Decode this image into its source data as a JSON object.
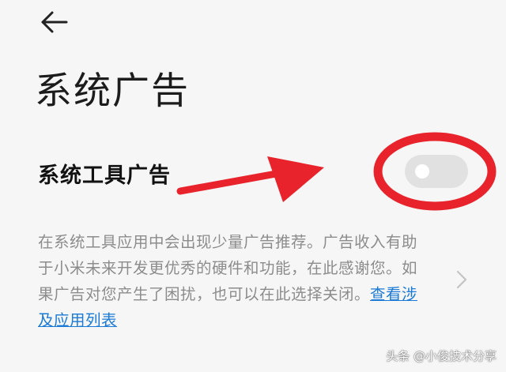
{
  "header": {
    "back_icon": "arrow-left-icon"
  },
  "page": {
    "title": "系统广告"
  },
  "setting": {
    "title": "系统工具广告",
    "toggle_state": "off",
    "description_text": "在系统工具应用中会出现少量广告推荐。广告收入有助于小米未来开发更优秀的硬件和功能，在此感谢您。如果广告对您产生了困扰，也可以在此选择关闭。",
    "description_link": "查看涉及应用列表",
    "chevron_icon": "chevron-right-icon"
  },
  "annotations": {
    "arrow_color": "#e8232b",
    "circle_color": "#e8232b"
  },
  "colors": {
    "background": "#f6f6f6",
    "toggle_off": "#e1e1e1",
    "link": "#1a7ad6",
    "secondary_text": "#8c8c8c"
  },
  "watermark": {
    "text": "头条 @小俊技术分享"
  }
}
